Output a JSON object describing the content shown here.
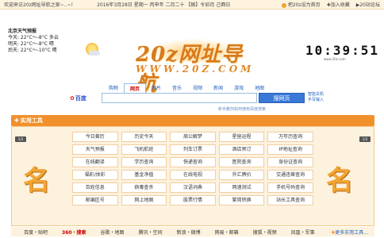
{
  "topbar": {
    "welcome": "欢迎来访20z网址导航之家~..~!",
    "date": "2016年3月28日 星期一  丙申年 二月二十 【猴】令卯月 己酉日",
    "set_home": "把20z设为首页",
    "add_fav": "加入收藏",
    "site_brand": "20站论坛"
  },
  "weather": {
    "title": "北京天气预报",
    "today": "今天:  22°C～-8°C  多云",
    "tomorrow": "明天:  22°C～-8°C  晴",
    "after": "后天:  22°C～-10°C  晴"
  },
  "logo": {
    "big": "20z网址导航",
    "url": "WWW.20Z.COM"
  },
  "clock": {
    "time": "10:39:51",
    "sub": "www.20z.com"
  },
  "search": {
    "tabs": [
      "购物",
      "网页",
      "图片",
      "音乐",
      "视频",
      "新闻",
      "游戏",
      "地图"
    ],
    "active_tab": "网页",
    "engine": "百度",
    "button": "搜网页",
    "side_links": [
      "智能关机",
      "手写输入"
    ],
    "tip": "新手教你如何使用百度搜索"
  },
  "section": {
    "title": "实用工具"
  },
  "side_badges": {
    "left": "1/3",
    "right": "1/3"
  },
  "tools": [
    "今日黄历",
    "历史今天",
    "周公解梦",
    "星座运程",
    "万年历查询",
    "天气预报",
    "飞机航班",
    "列车订票",
    "酒店预订",
    "IP地址查询",
    "在线翻译",
    "学历查询",
    "快递查询",
    "医院查询",
    "身份证查询",
    "福彩/体彩",
    "基金净值",
    "在线电视",
    "外汇牌价",
    "交通违章查询",
    "百姓信息",
    "病毒查杀",
    "汉语词典",
    "网速测试",
    "手机号码查询",
    "邮编区号",
    "网上地图",
    "股票行情",
    "繁简转换",
    "站长工具查询"
  ],
  "bottom_nav": {
    "links": [
      "百度・贴吧",
      "360・搜索",
      "谷歌・地图",
      "腾讯・空间",
      "新浪・微博",
      "网易・邮箱",
      "搜狐・视频",
      "凤凰・军事"
    ],
    "more": "更多实用工具..."
  },
  "colors": {
    "accent": "#f2902c",
    "panel_bg": "#fdf2de",
    "link": "#1f5fbf"
  }
}
